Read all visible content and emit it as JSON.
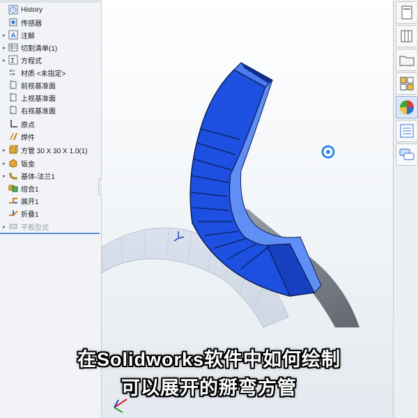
{
  "feature_tree": {
    "items": [
      {
        "label": "History",
        "icon": "history-icon",
        "expandable": false
      },
      {
        "label": "传感器",
        "icon": "sensor-icon",
        "expandable": false
      },
      {
        "label": "注解",
        "icon": "annotation-icon",
        "expandable": true
      },
      {
        "label": "切割清单(1)",
        "icon": "cut-list-icon",
        "expandable": true
      },
      {
        "label": "方程式",
        "icon": "equation-icon",
        "expandable": true
      },
      {
        "label": "材质 <未指定>",
        "icon": "material-icon",
        "expandable": false
      },
      {
        "label": "前视基准面",
        "icon": "plane-icon",
        "expandable": false
      },
      {
        "label": "上视基准面",
        "icon": "plane-icon",
        "expandable": false
      },
      {
        "label": "右视基准面",
        "icon": "plane-icon",
        "expandable": false
      },
      {
        "label": "原点",
        "icon": "origin-icon",
        "expandable": false
      },
      {
        "label": "焊件",
        "icon": "weldment-icon",
        "expandable": false
      },
      {
        "label": "方管 30 X 30 X 1.0(1)",
        "icon": "structural-member-icon",
        "expandable": true
      },
      {
        "label": "钣金",
        "icon": "sheet-metal-icon",
        "expandable": true
      },
      {
        "label": "基体-法兰1",
        "icon": "base-flange-icon",
        "expandable": true
      },
      {
        "label": "组合1",
        "icon": "combine-icon",
        "expandable": false
      },
      {
        "label": "展开1",
        "icon": "unfold-icon",
        "expandable": false
      },
      {
        "label": "折叠1",
        "icon": "fold-icon",
        "expandable": false
      },
      {
        "label": "平板型式",
        "icon": "flat-pattern-icon",
        "expandable": true,
        "disabled": true
      }
    ]
  },
  "task_pane": {
    "buttons": [
      {
        "icon": "solidworks-resources-icon"
      },
      {
        "icon": "design-library-icon"
      },
      {
        "icon": "file-explorer-icon"
      },
      {
        "icon": "view-palette-icon"
      },
      {
        "icon": "appearances-icon"
      },
      {
        "icon": "custom-properties-icon"
      },
      {
        "icon": "forum-icon"
      }
    ]
  },
  "colors": {
    "model_blue": "#1d4fe0",
    "model_edge": "#0a1f55",
    "selection_divider": "#5a8ed6"
  },
  "caption": {
    "line1": "在Solidworks软件中如何绘制",
    "line2": "可以展开的掰弯方管"
  }
}
